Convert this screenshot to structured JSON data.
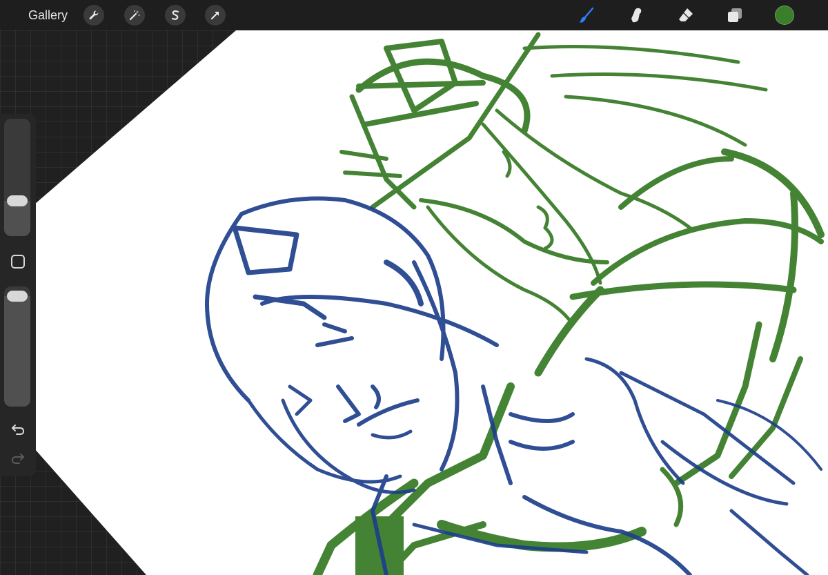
{
  "topbar": {
    "gallery_label": "Gallery",
    "left_tools": [
      {
        "icon": "wrench-icon",
        "name": "actions"
      },
      {
        "icon": "magic-wand-icon",
        "name": "adjustments"
      },
      {
        "icon": "selection-s-icon",
        "name": "selection"
      },
      {
        "icon": "arrow-cursor-icon",
        "name": "transform"
      }
    ],
    "right_tools": [
      {
        "icon": "brush-icon",
        "name": "paint",
        "active": true
      },
      {
        "icon": "smudge-icon",
        "name": "smudge"
      },
      {
        "icon": "eraser-icon",
        "name": "erase"
      },
      {
        "icon": "layers-icon",
        "name": "layers"
      }
    ],
    "current_color": "#3a7d2a"
  },
  "sidebar": {
    "brush_size_level": 0.3,
    "opacity_level": 0.92,
    "modify_button_icon": "square-icon",
    "undo_icon": "undo-arrow-icon",
    "redo_icon": "redo-arrow-icon"
  },
  "colors": {
    "active_tool": "#2d7ff9",
    "sketch_green": "#3a7d2a",
    "sketch_blue": "#1e3f8a",
    "canvas": "#ffffff"
  }
}
